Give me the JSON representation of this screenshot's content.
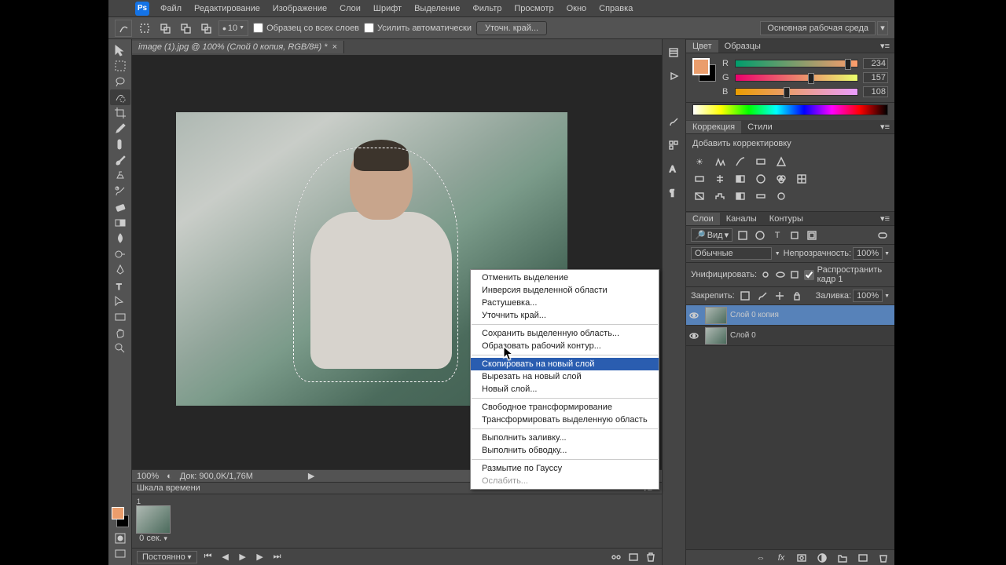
{
  "app": {
    "logo": "Ps",
    "menu": [
      "Файл",
      "Редактирование",
      "Изображение",
      "Слои",
      "Шрифт",
      "Выделение",
      "Фильтр",
      "Просмотр",
      "Окно",
      "Справка"
    ]
  },
  "options": {
    "brush_size": "10",
    "sample_all": "Образец со всех слоев",
    "auto_enhance": "Усилить автоматически",
    "refine": "Уточн. край...",
    "workspace": "Основная рабочая среда"
  },
  "doc": {
    "title": "image (1).jpg @ 100% (Слой 0 копия, RGB/8#) *"
  },
  "status": {
    "zoom": "100%",
    "doc_size": "Док: 900,0K/1,76M"
  },
  "timeline": {
    "title": "Шкала времени",
    "frame_label": "1",
    "delay": "0 сек.",
    "loop": "Постоянно"
  },
  "color": {
    "fg": "#ea9d6c",
    "tab_color": "Цвет",
    "tab_swatches": "Образцы",
    "r": {
      "lbl": "R",
      "val": "234",
      "grad": "linear-gradient(90deg,#009d6c,#ff9d6c)"
    },
    "g": {
      "lbl": "G",
      "val": "157",
      "grad": "linear-gradient(90deg,#ea006c,#eaff6c)"
    },
    "b": {
      "lbl": "B",
      "val": "108",
      "grad": "linear-gradient(90deg,#ea9d00,#ea9dff)"
    }
  },
  "adjust": {
    "tab_adj": "Коррекция",
    "tab_styles": "Стили",
    "title": "Добавить корректировку"
  },
  "layers": {
    "tab_layers": "Слои",
    "tab_channels": "Каналы",
    "tab_paths": "Контуры",
    "kind": "Вид",
    "blend": "Обычные",
    "opacity_lbl": "Непрозрачность:",
    "opacity": "100%",
    "unify": "Унифицировать:",
    "propagate": "Распространить кадр 1",
    "lock_lbl": "Закрепить:",
    "fill_lbl": "Заливка:",
    "fill": "100%",
    "items": [
      {
        "name": "Слой 0 копия",
        "selected": true
      },
      {
        "name": "Слой 0",
        "selected": false
      }
    ]
  },
  "context": {
    "items": [
      {
        "label": "Отменить выделение"
      },
      {
        "label": "Инверсия выделенной области"
      },
      {
        "label": "Растушевка..."
      },
      {
        "label": "Уточнить край..."
      },
      {
        "sep": true
      },
      {
        "label": "Сохранить выделенную область..."
      },
      {
        "label": "Образовать рабочий контур..."
      },
      {
        "sep": true
      },
      {
        "label": "Скопировать на новый слой",
        "highlight": true
      },
      {
        "label": "Вырезать на новый слой"
      },
      {
        "label": "Новый слой..."
      },
      {
        "sep": true
      },
      {
        "label": "Свободное трансформирование"
      },
      {
        "label": "Трансформировать выделенную область"
      },
      {
        "sep": true
      },
      {
        "label": "Выполнить заливку..."
      },
      {
        "label": "Выполнить обводку..."
      },
      {
        "sep": true
      },
      {
        "label": "Размытие по Гауссу"
      },
      {
        "label": "Ослабить...",
        "disabled": true
      }
    ]
  }
}
